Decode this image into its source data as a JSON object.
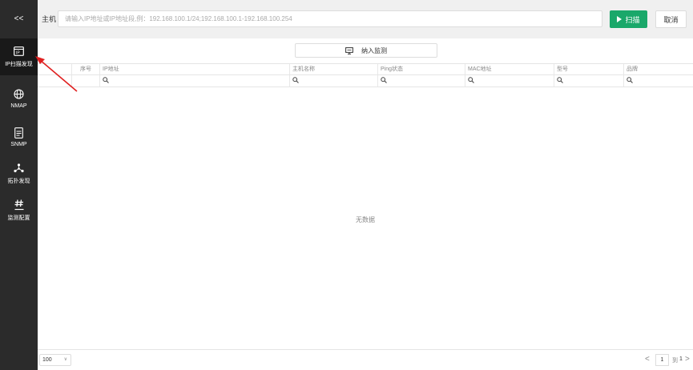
{
  "sidebar": {
    "collapse_label": "<<",
    "items": [
      {
        "icon": "ip-scan-icon",
        "label": "IP扫描发现",
        "active": true
      },
      {
        "icon": "globe-icon",
        "label": "NMAP"
      },
      {
        "icon": "document-icon",
        "label": "SNMP"
      },
      {
        "icon": "topology-icon",
        "label": "拓扑发现"
      },
      {
        "icon": "monitor-config-icon",
        "label": "监测配置"
      }
    ]
  },
  "topbar": {
    "host_label": "主机",
    "host_placeholder": "请输入IP地址或IP地址段,例：192.168.100.1/24;192.168.100.1-192.168.100.254",
    "scan_label": "扫描",
    "cancel_label": "取消"
  },
  "monitor_button_label": "纳入监测",
  "table": {
    "columns": [
      "序号",
      "IP地址",
      "主机名称",
      "Ping状态",
      "MAC地址",
      "型号",
      "品牌"
    ],
    "empty_text": "无数据"
  },
  "pagination": {
    "page_size": "100",
    "current_page": "1",
    "to_label": "到",
    "total_pages": "1"
  },
  "colors": {
    "sidebar_bg": "#2b2b2b",
    "accent_green": "#1aa86a",
    "annotation_red": "#e02020"
  }
}
